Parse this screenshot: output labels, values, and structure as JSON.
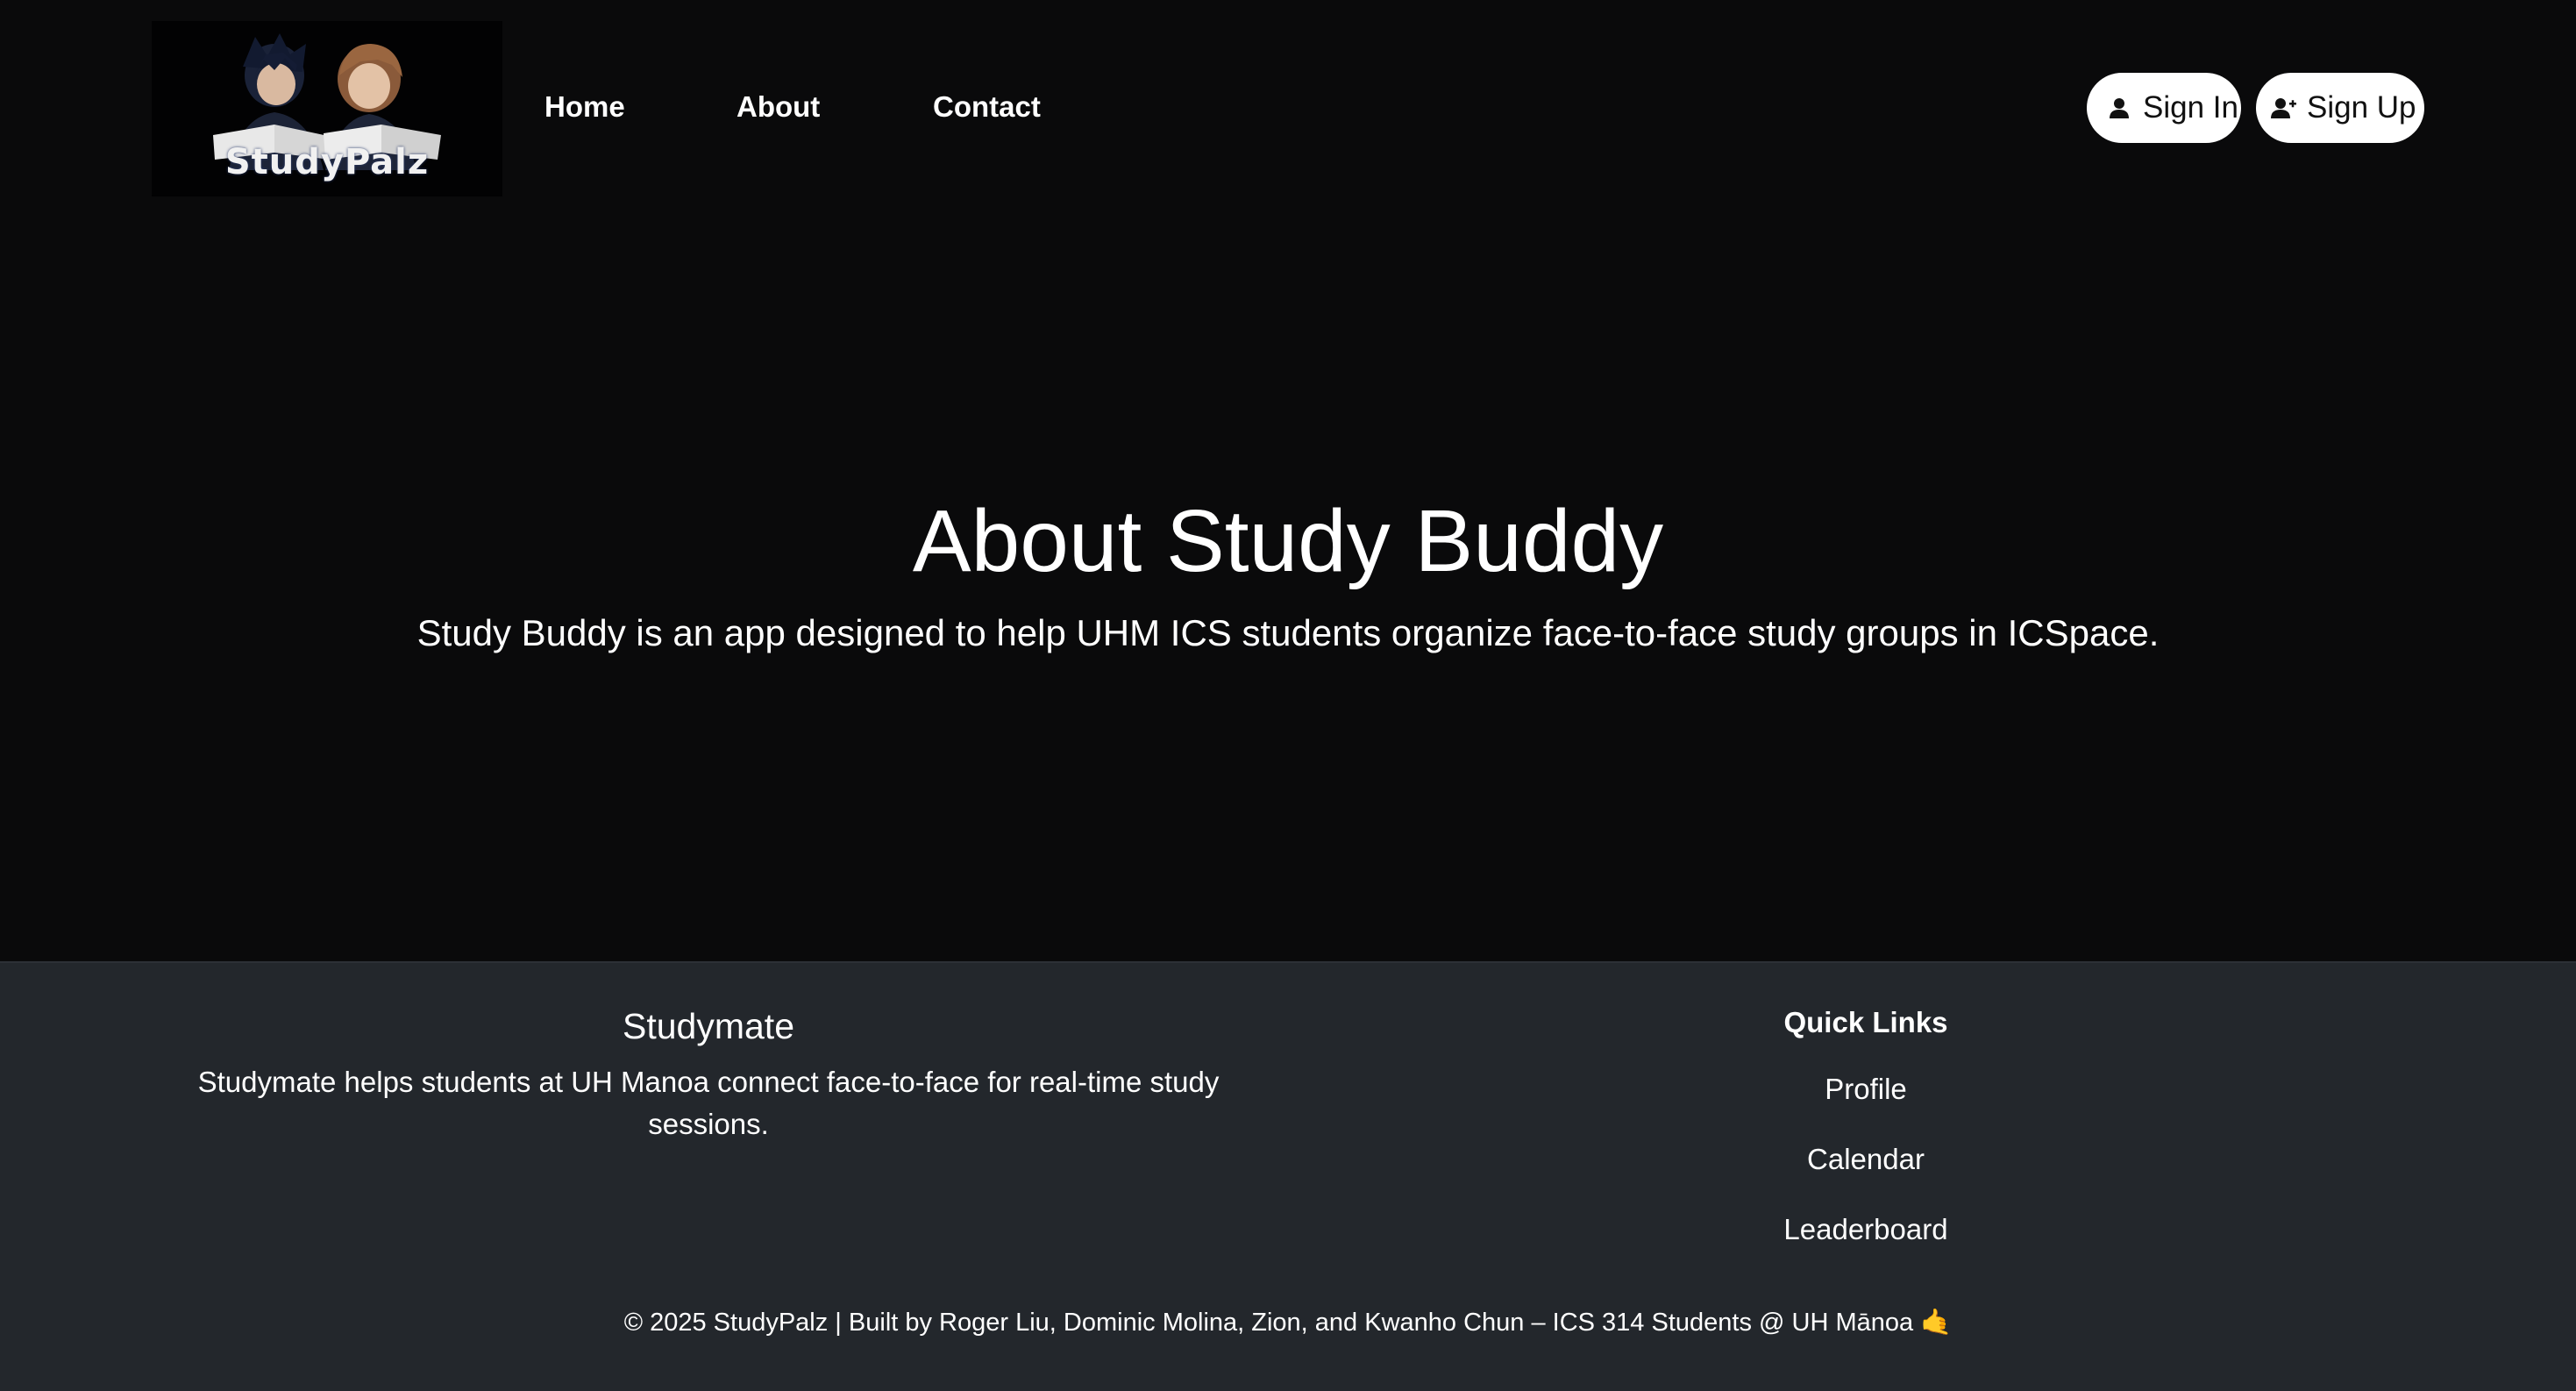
{
  "navbar": {
    "logo_text": "StudyPalz",
    "links": [
      "Home",
      "About",
      "Contact"
    ],
    "sign_in_label": "Sign In",
    "sign_up_label": "Sign Up"
  },
  "hero": {
    "title": "About Study Buddy",
    "description": "Study Buddy is an app designed to help UHM ICS students organize face-to-face study groups in ICSpace."
  },
  "footer": {
    "brand_title": "Studymate",
    "brand_description": "Studymate helps students at UH Manoa connect face-to-face for real-time study sessions.",
    "quick_links_title": "Quick Links",
    "quick_links": [
      "Profile",
      "Calendar",
      "Leaderboard"
    ],
    "copyright": "© 2025 StudyPalz | Built by Roger Liu, Dominic Molina, Zion, and Kwanho Chun – ICS 314 Students @ UH Mānoa",
    "copyright_emoji": "🤙"
  },
  "colors": {
    "background": "#0a0a0b",
    "footer_background": "#23272c",
    "text": "#ffffff",
    "button_background": "#ffffff",
    "button_text": "#111111"
  },
  "icons": {
    "sign_in": "person-icon",
    "sign_up": "person-plus-icon"
  }
}
